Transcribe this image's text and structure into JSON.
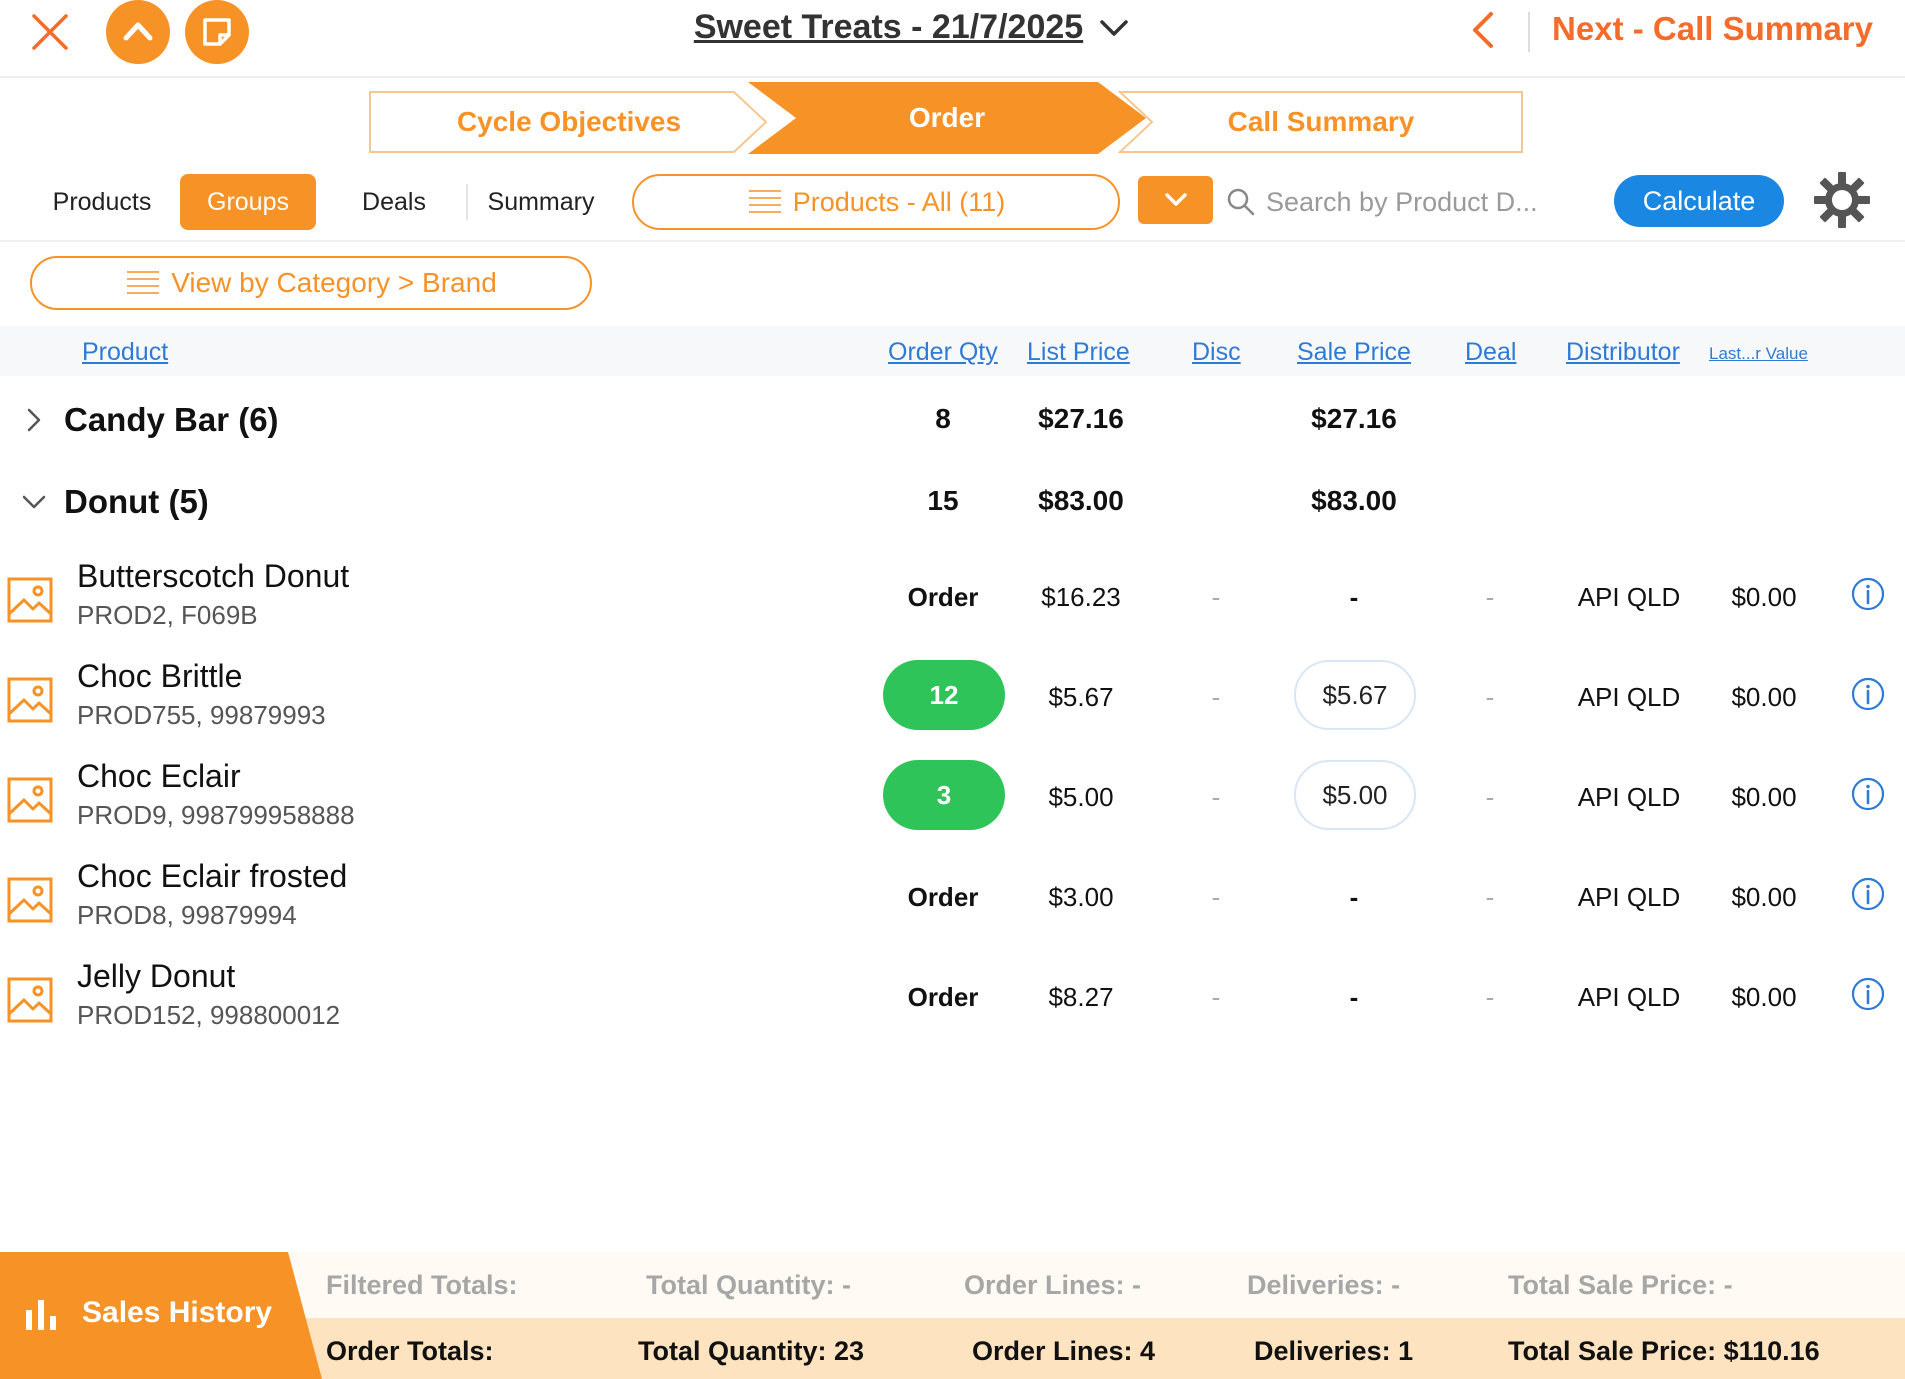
{
  "header": {
    "title": "Sweet Treats - 21/7/2025",
    "next_label": "Next - Call Summary"
  },
  "stepper": {
    "steps": [
      "Cycle Objectives",
      "Order",
      "Call Summary"
    ],
    "active": "Order"
  },
  "tabs": {
    "products": "Products",
    "groups": "Groups",
    "deals": "Deals",
    "summary": "Summary",
    "active": "Groups"
  },
  "filter": {
    "label": "Products - All (11)"
  },
  "search": {
    "placeholder": "Search by Product D..."
  },
  "calculate_label": "Calculate",
  "view_by": "View by Category > Brand",
  "columns": {
    "product": "Product",
    "order_qty": "Order Qty",
    "list_price": "List Price",
    "disc": "Disc",
    "sale_price": "Sale Price",
    "deal": "Deal",
    "distributor": "Distributor",
    "last_value": "Last...r Value"
  },
  "groups": [
    {
      "name": "Candy Bar (6)",
      "qty": "8",
      "list_price": "$27.16",
      "sale_price": "$27.16",
      "expanded": false
    },
    {
      "name": "Donut (5)",
      "qty": "15",
      "list_price": "$83.00",
      "sale_price": "$83.00",
      "expanded": true
    }
  ],
  "products": [
    {
      "name": "Butterscotch Donut",
      "code": "PROD2, F069B",
      "qty": "Order",
      "list_price": "$16.23",
      "disc": "-",
      "sale_price": "-",
      "deal": "-",
      "distributor": "API QLD",
      "last_value": "$0.00"
    },
    {
      "name": "Choc Brittle",
      "code": "PROD755, 99879993",
      "qty": "12",
      "list_price": "$5.67",
      "disc": "-",
      "sale_price": "$5.67",
      "deal": "-",
      "distributor": "API QLD",
      "last_value": "$0.00"
    },
    {
      "name": "Choc Eclair",
      "code": "PROD9, 998799958888",
      "qty": "3",
      "list_price": "$5.00",
      "disc": "-",
      "sale_price": "$5.00",
      "deal": "-",
      "distributor": "API QLD",
      "last_value": "$0.00"
    },
    {
      "name": "Choc Eclair frosted",
      "code": "PROD8, 99879994",
      "qty": "Order",
      "list_price": "$3.00",
      "disc": "-",
      "sale_price": "-",
      "deal": "-",
      "distributor": "API QLD",
      "last_value": "$0.00"
    },
    {
      "name": "Jelly Donut",
      "code": "PROD152, 998800012",
      "qty": "Order",
      "list_price": "$8.27",
      "disc": "-",
      "sale_price": "-",
      "deal": "-",
      "distributor": "API QLD",
      "last_value": "$0.00"
    }
  ],
  "footer": {
    "sales_history": "Sales History",
    "filtered": {
      "label": "Filtered Totals:",
      "total_quantity": "Total Quantity: -",
      "order_lines": "Order Lines: -",
      "deliveries": "Deliveries: -",
      "total_sale_price": "Total Sale Price: -"
    },
    "order": {
      "label": "Order Totals:",
      "total_quantity": "Total Quantity: 23",
      "order_lines": "Order Lines: 4",
      "deliveries": "Deliveries: 1",
      "total_sale_price": "Total Sale Price: $110.16"
    }
  },
  "colors": {
    "accent": "#f79226",
    "next": "#f46b2a",
    "link": "#2e7bd6",
    "calculate": "#1a87e3",
    "qty_green": "#2ec45a",
    "footer_band": "#fde3bf"
  }
}
